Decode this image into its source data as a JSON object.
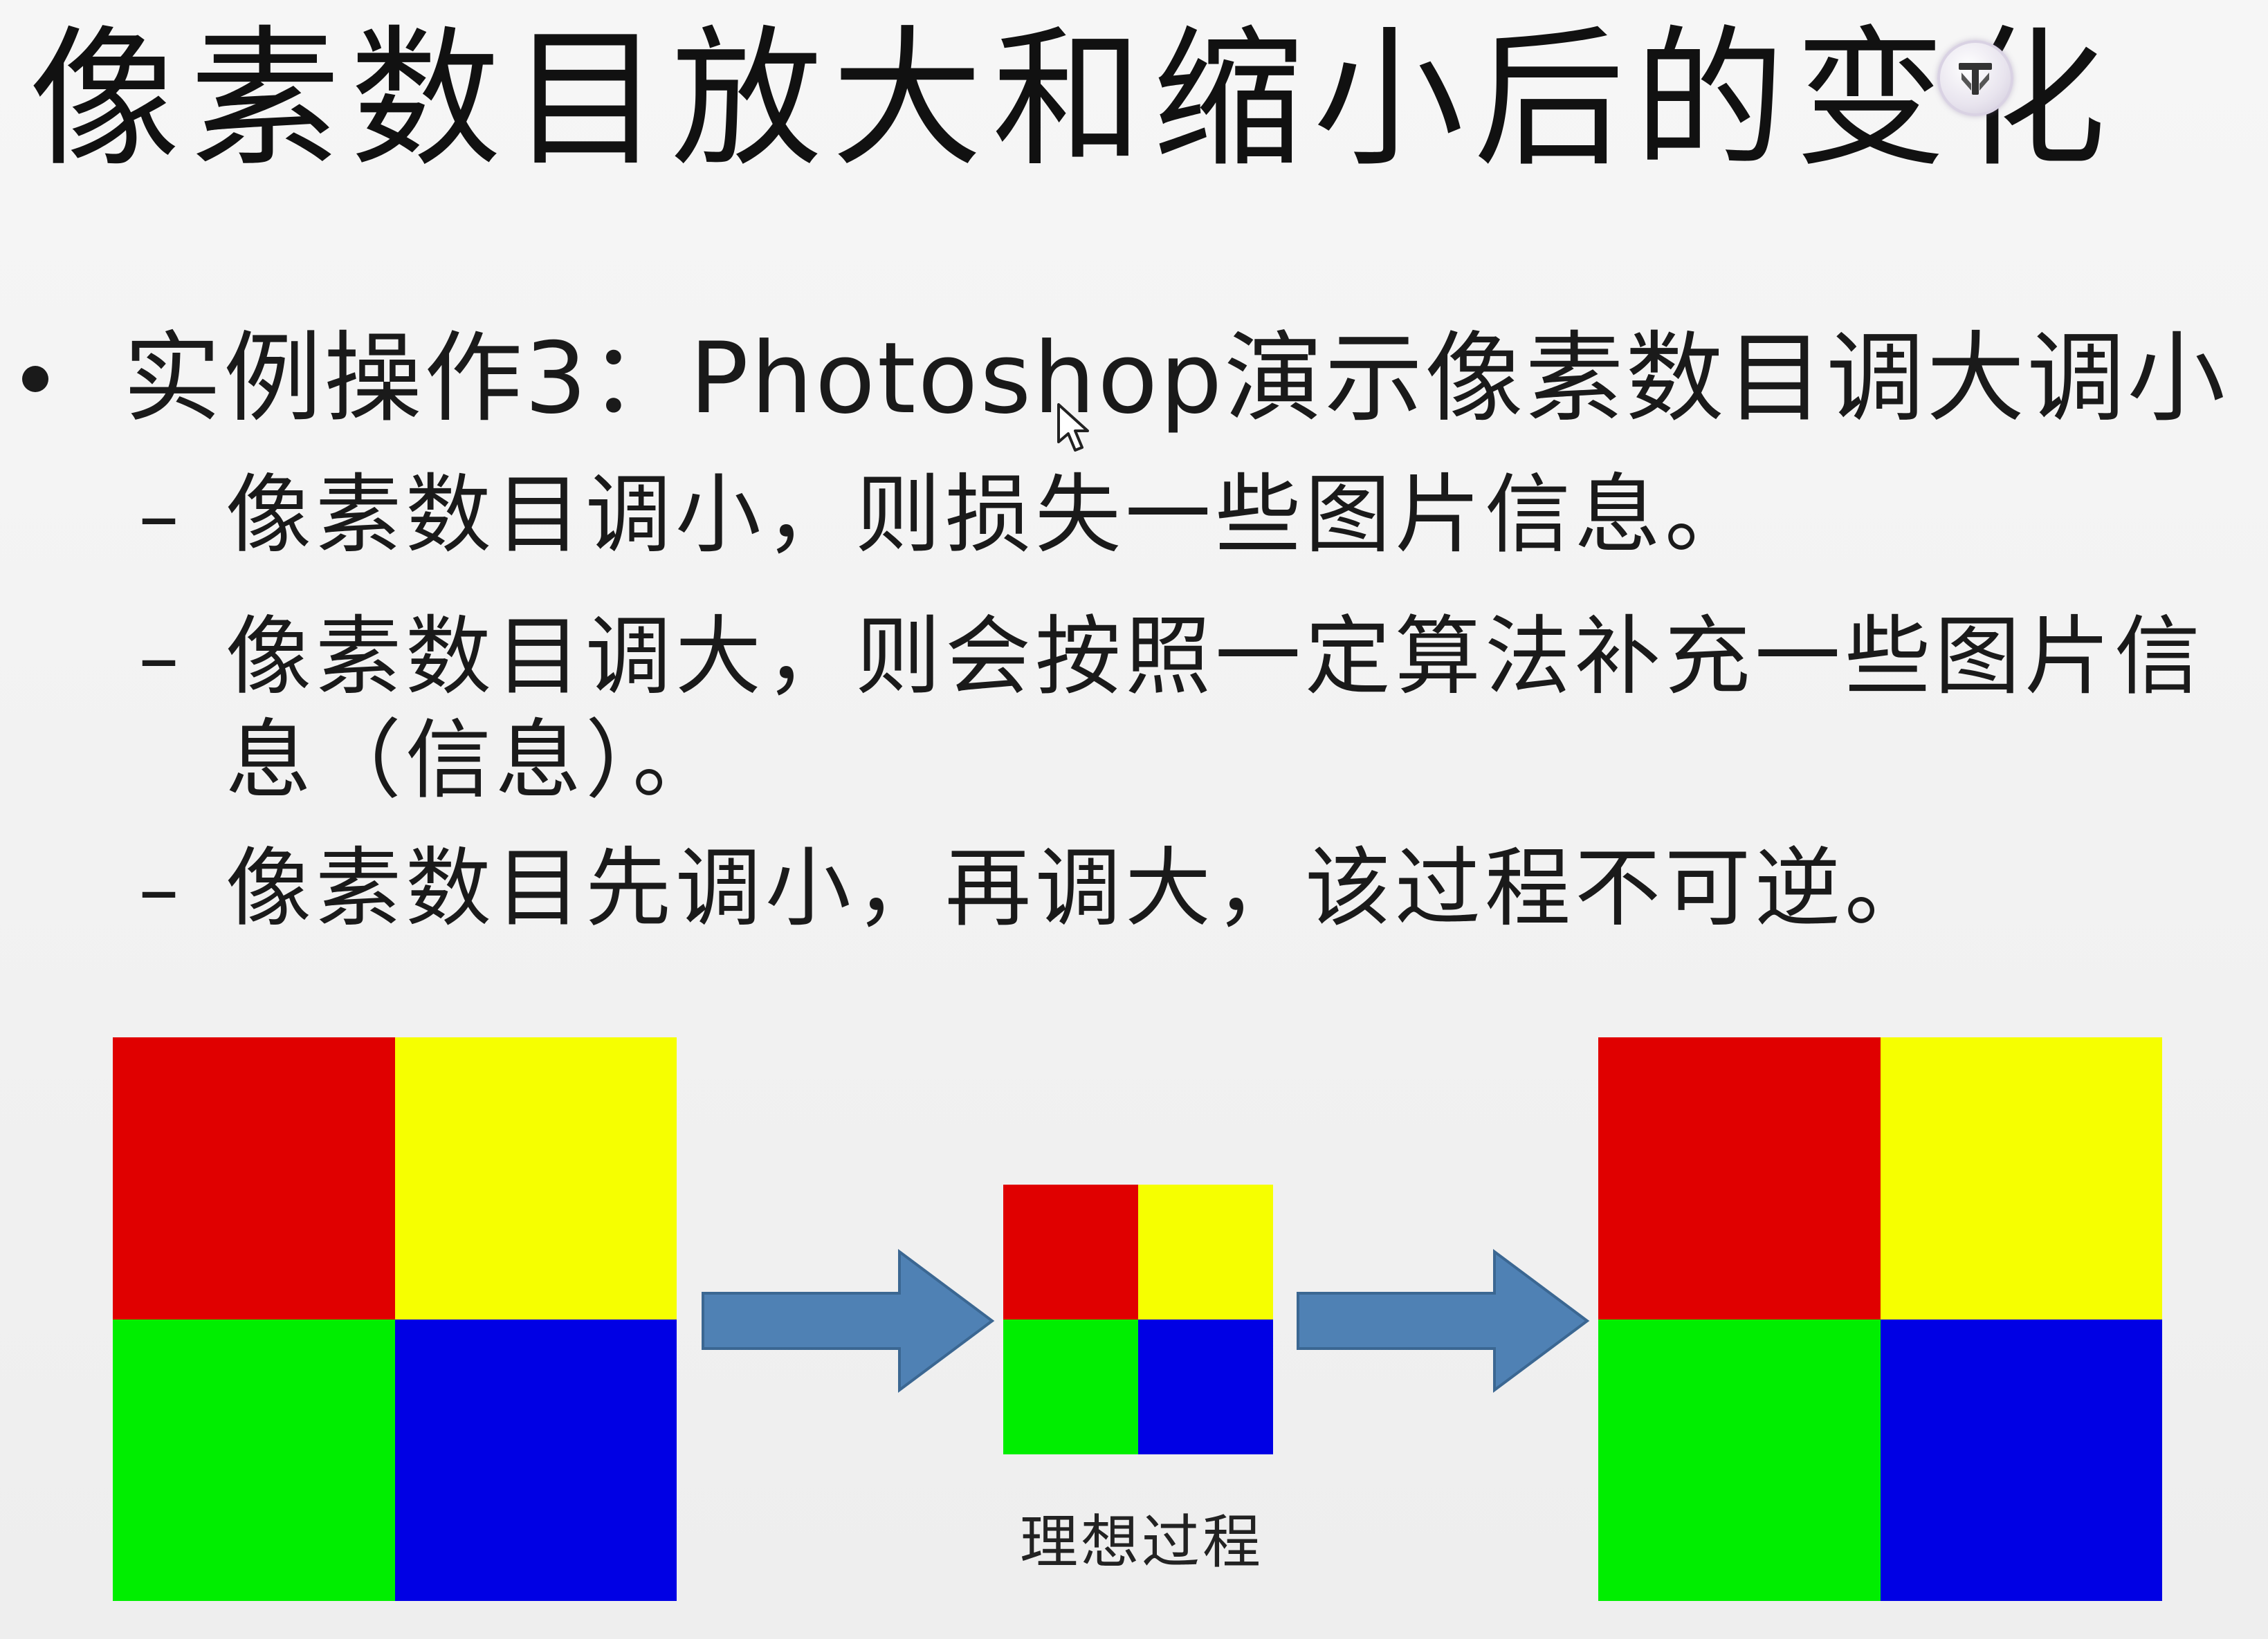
{
  "slide": {
    "title": "像素数目放大和缩小后的变化",
    "bullet": "实例操作3：Photoshop演示像素数目调大调小",
    "sub_bullets": [
      {
        "dash": "–",
        "text": "像素数目调小，则损失一些图片信息。"
      },
      {
        "dash": "–",
        "text": "像素数目调大，则会按照一定算法补充一些图片信息（信息）。"
      },
      {
        "dash": "–",
        "text": "像素数目先调小，再调大，该过程不可逆。"
      }
    ],
    "caption": "理想过程"
  },
  "colors": {
    "red": "#e00000",
    "yellow": "#f6ff00",
    "green": "#00ee00",
    "blue": "#0000e4",
    "arrow_fill": "#4f81b4",
    "arrow_stroke": "#3b6792"
  },
  "icons": {
    "logo": "watermark-logo-icon",
    "cursor": "mouse-cursor-icon",
    "arrow": "right-arrow-icon"
  }
}
